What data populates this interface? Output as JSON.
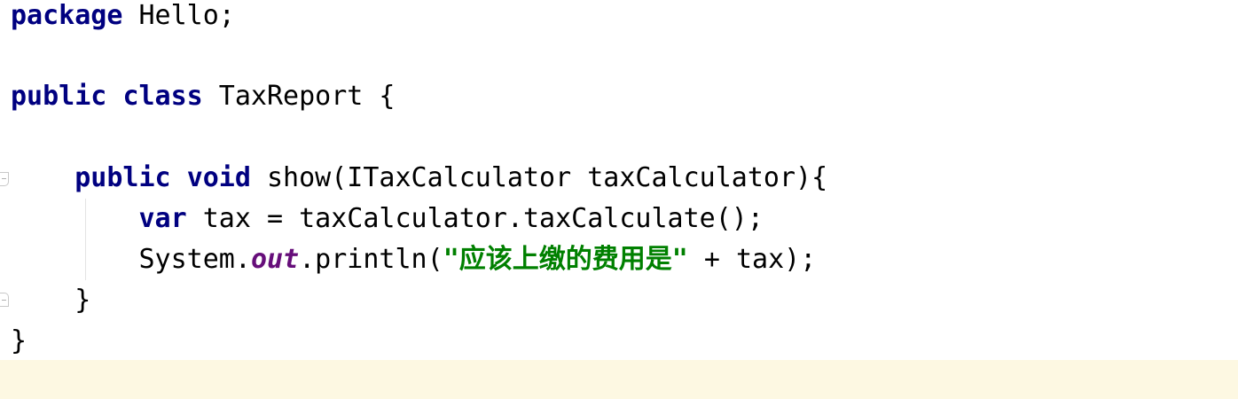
{
  "editor": {
    "language": "java",
    "colors": {
      "keyword": "#000080",
      "static_field": "#660e7a",
      "string": "#008000",
      "text": "#000000",
      "current_line_background": "#fdf8e2"
    },
    "gutter_icons": [
      "fold-open-icon",
      "fold-close-icon"
    ],
    "lines": {
      "l1": {
        "kw1": "package",
        "rest": " Hello;"
      },
      "l3": {
        "kw1": "public",
        "kw2": "class",
        "rest": " TaxReport {"
      },
      "l5": {
        "indent": "    ",
        "kw1": "public",
        "kw2": "void",
        "rest": " show(ITaxCalculator taxCalculator){"
      },
      "l6": {
        "indent": "        ",
        "kw1": "var",
        "rest": " tax = taxCalculator.taxCalculate();"
      },
      "l7": {
        "indent": "        ",
        "pre": "System.",
        "field": "out",
        "mid": ".println(",
        "str": "\"应该上缴的费用是\"",
        "rest": " + tax);"
      },
      "l8": {
        "text": "    }"
      },
      "l9": {
        "text": "}"
      }
    }
  }
}
